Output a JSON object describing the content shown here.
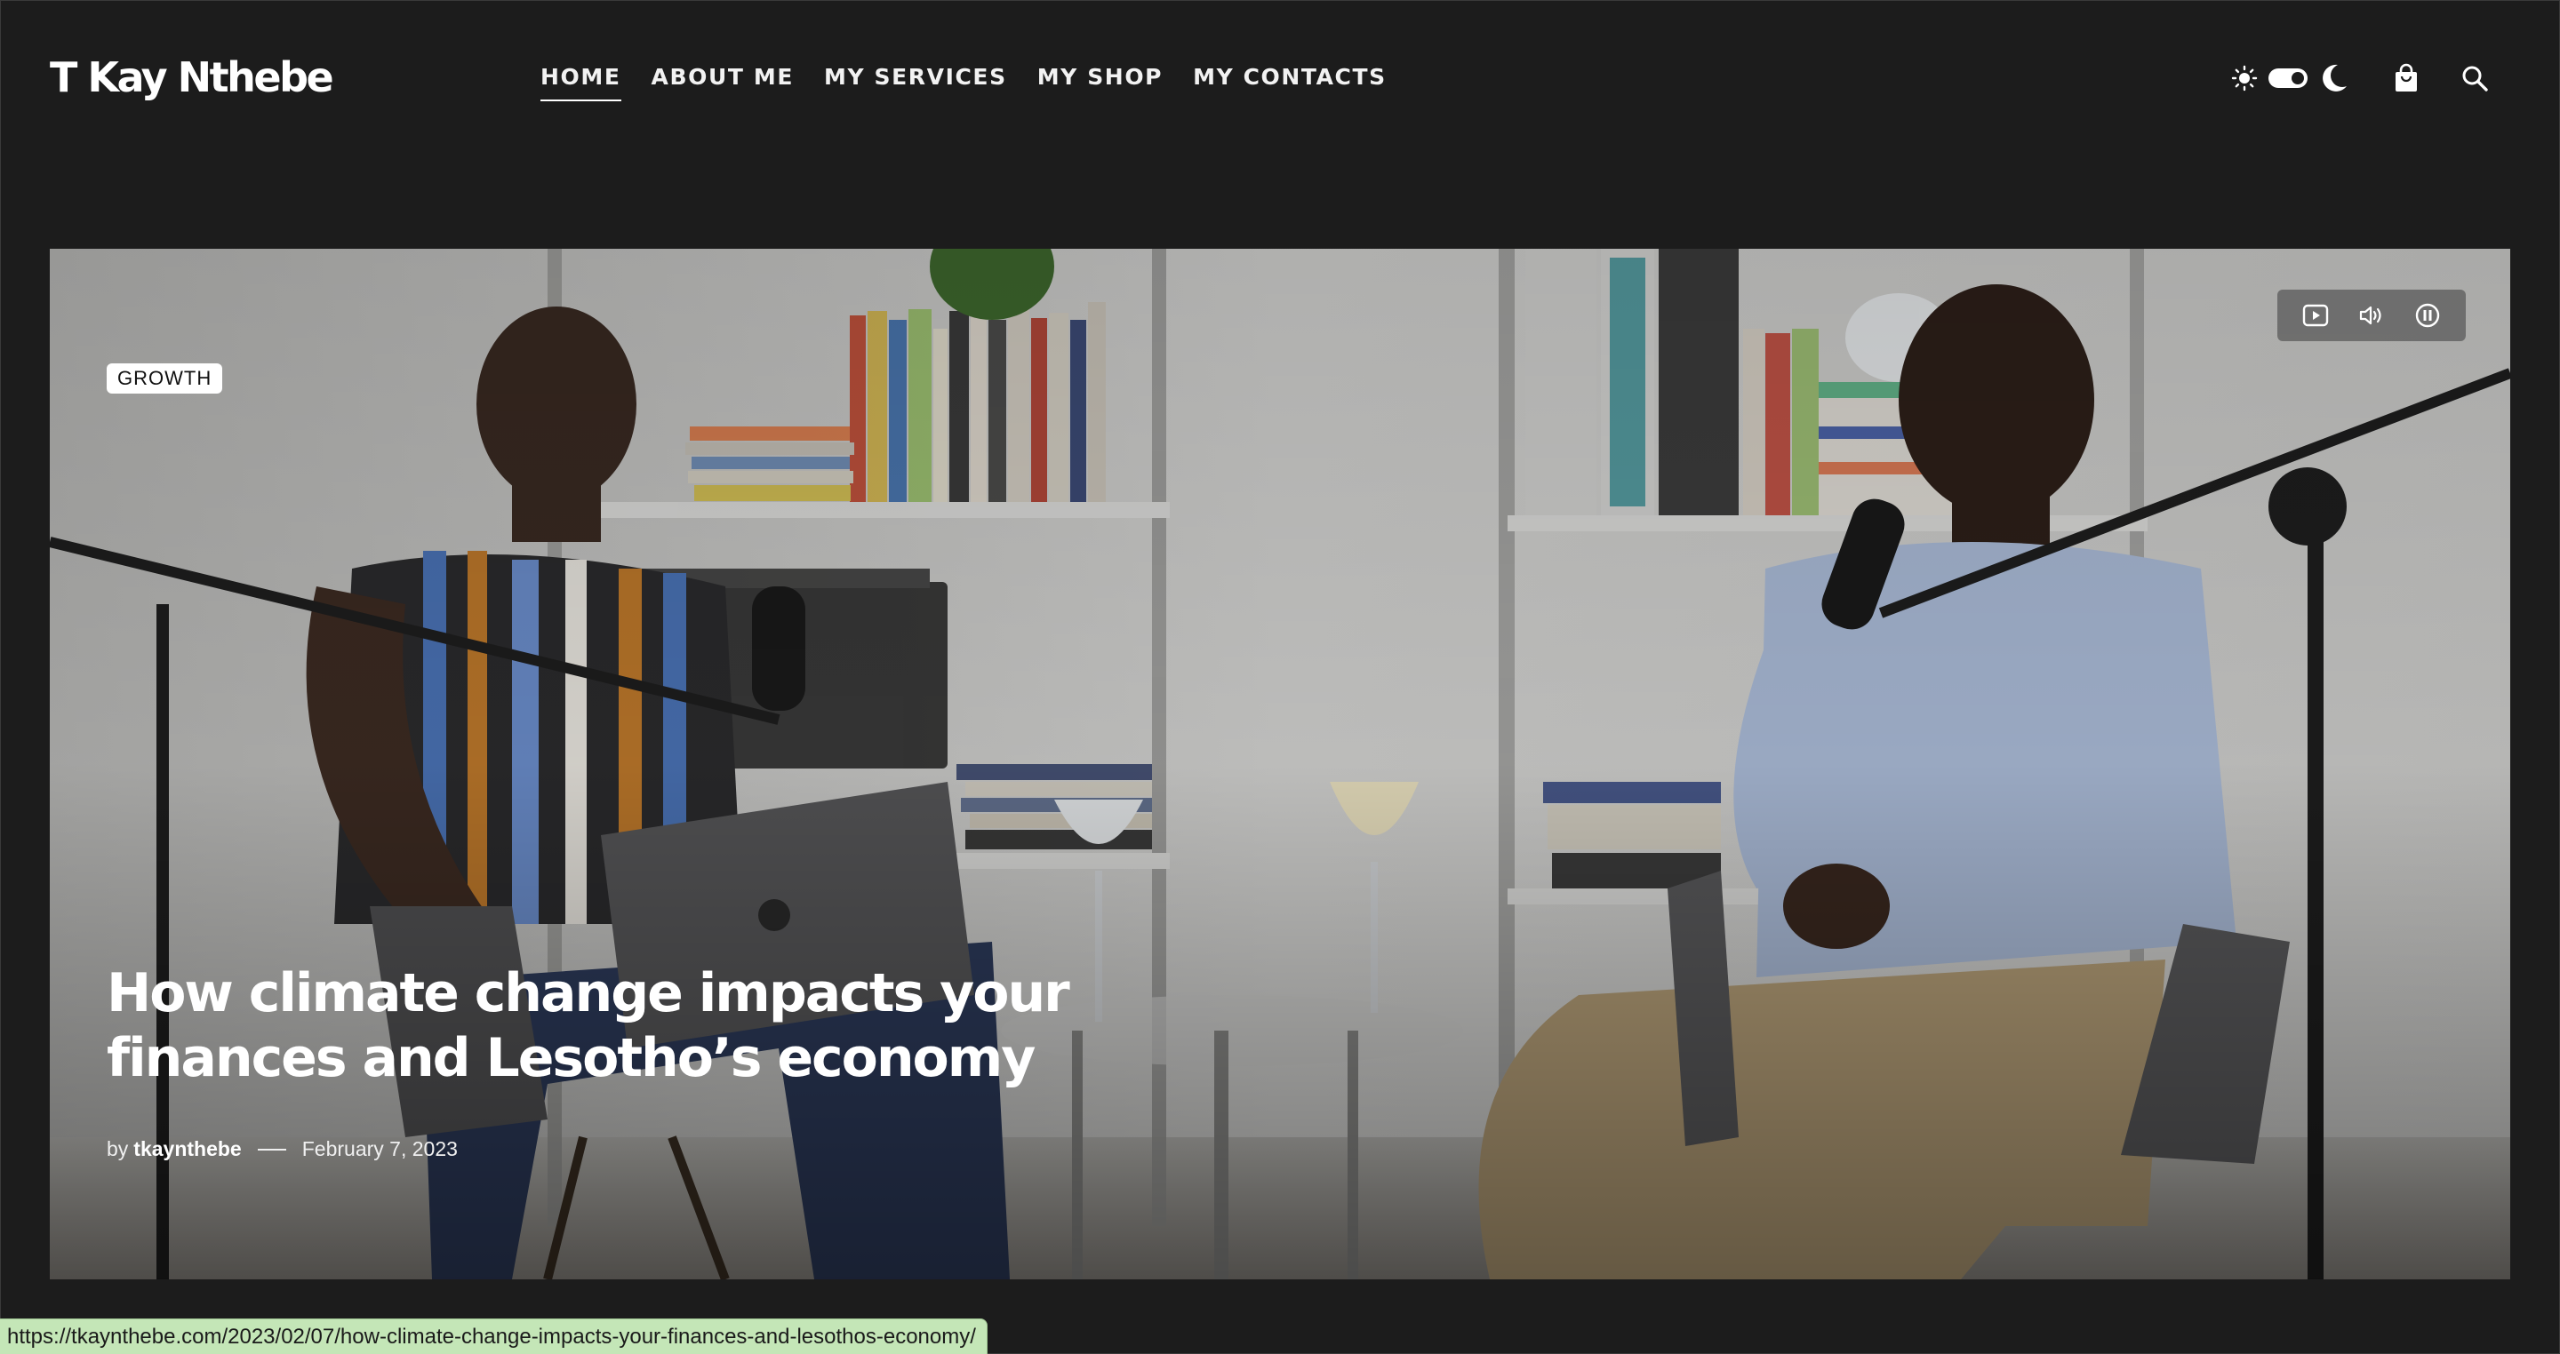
{
  "site": {
    "logo": "T Kay Nthebe"
  },
  "nav": {
    "items": [
      {
        "label": "HOME",
        "active": true
      },
      {
        "label": "ABOUT ME",
        "active": false
      },
      {
        "label": "MY SERVICES",
        "active": false
      },
      {
        "label": "MY SHOP",
        "active": false
      },
      {
        "label": "MY CONTACTS",
        "active": false
      }
    ]
  },
  "header_tools": {
    "icons": [
      "sun-icon",
      "theme-toggle",
      "moon-icon",
      "shopping-bag-icon",
      "search-icon"
    ],
    "theme_toggle_on": true
  },
  "hero": {
    "category": "GROWTH",
    "title": "How climate change impacts your finances and Lesotho’s economy",
    "by_label": "by",
    "author": "tkaynthebe",
    "date": "February 7, 2023",
    "video_controls": [
      "play-icon",
      "volume-icon",
      "pause-icon"
    ]
  },
  "statusbar": {
    "url": "https://tkaynthebe.com/2023/02/07/how-climate-change-impacts-your-finances-and-lesothos-economy/"
  },
  "colors": {
    "background": "#1c1c1c",
    "text": "#ffffff",
    "statusbar": "#c4e6b7"
  }
}
